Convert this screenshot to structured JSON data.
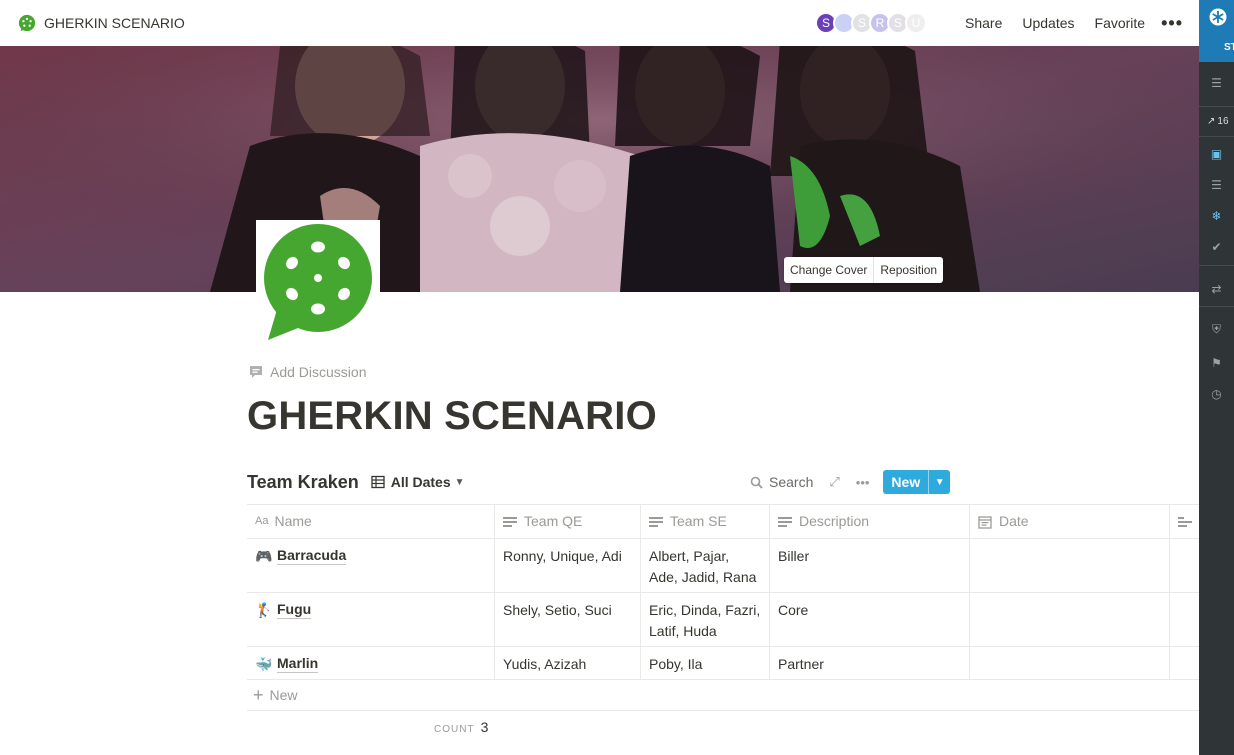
{
  "topbar": {
    "title": "GHERKIN SCENARIO",
    "avatars": [
      {
        "initial": "S",
        "color": "#6b3fb8"
      },
      {
        "initial": "",
        "color": "#c9d1f6"
      },
      {
        "initial": "S",
        "color": "#e2e2e6"
      },
      {
        "initial": "R",
        "color": "#c7c2ec"
      },
      {
        "initial": "S",
        "color": "#e2dfe6"
      },
      {
        "initial": "U",
        "color": "#eeeeee"
      }
    ],
    "share_label": "Share",
    "updates_label": "Updates",
    "favorite_label": "Favorite",
    "more_label": "•••"
  },
  "cover": {
    "change_cover_label": "Change Cover",
    "reposition_label": "Reposition"
  },
  "page": {
    "add_discussion_label": "Add Discussion",
    "title": "GHERKIN SCENARIO"
  },
  "database": {
    "name": "Team Kraken",
    "view_label": "All Dates",
    "search_label": "Search",
    "new_label": "New",
    "columns": [
      {
        "label": "Name",
        "icon": "Aa"
      },
      {
        "label": "Team QE",
        "icon": "text-icon"
      },
      {
        "label": "Team SE",
        "icon": "text-icon"
      },
      {
        "label": "Description",
        "icon": "text-icon"
      },
      {
        "label": "Date",
        "icon": "calendar-icon"
      }
    ],
    "rows": [
      {
        "emoji": "🎮",
        "name": "Barracuda",
        "team_qe": "Ronny, Unique, Adi",
        "team_se": "Albert, Pajar, Ade, Jadid, Rana",
        "description": "Biller",
        "date": ""
      },
      {
        "emoji": "🏌",
        "name": "Fugu",
        "team_qe": "Shely, Setio, Suci",
        "team_se": "Eric, Dinda, Fazri, Latif, Huda",
        "description": "Core",
        "date": ""
      },
      {
        "emoji": "🐳",
        "name": "Marlin",
        "team_qe": "Yudis, Azizah",
        "team_se": "Poby, Ila",
        "description": "Partner",
        "date": ""
      }
    ],
    "add_row_label": "New",
    "count_key": "COUNT",
    "count_value": "3"
  },
  "sidebar": {
    "top_label": "ST",
    "trend_value": "16"
  },
  "colors": {
    "brand_green": "#45a72f",
    "accent_blue": "#2eaadc",
    "sidebar_dark": "#2f3437",
    "sidebar_top": "#1f7bb6"
  }
}
